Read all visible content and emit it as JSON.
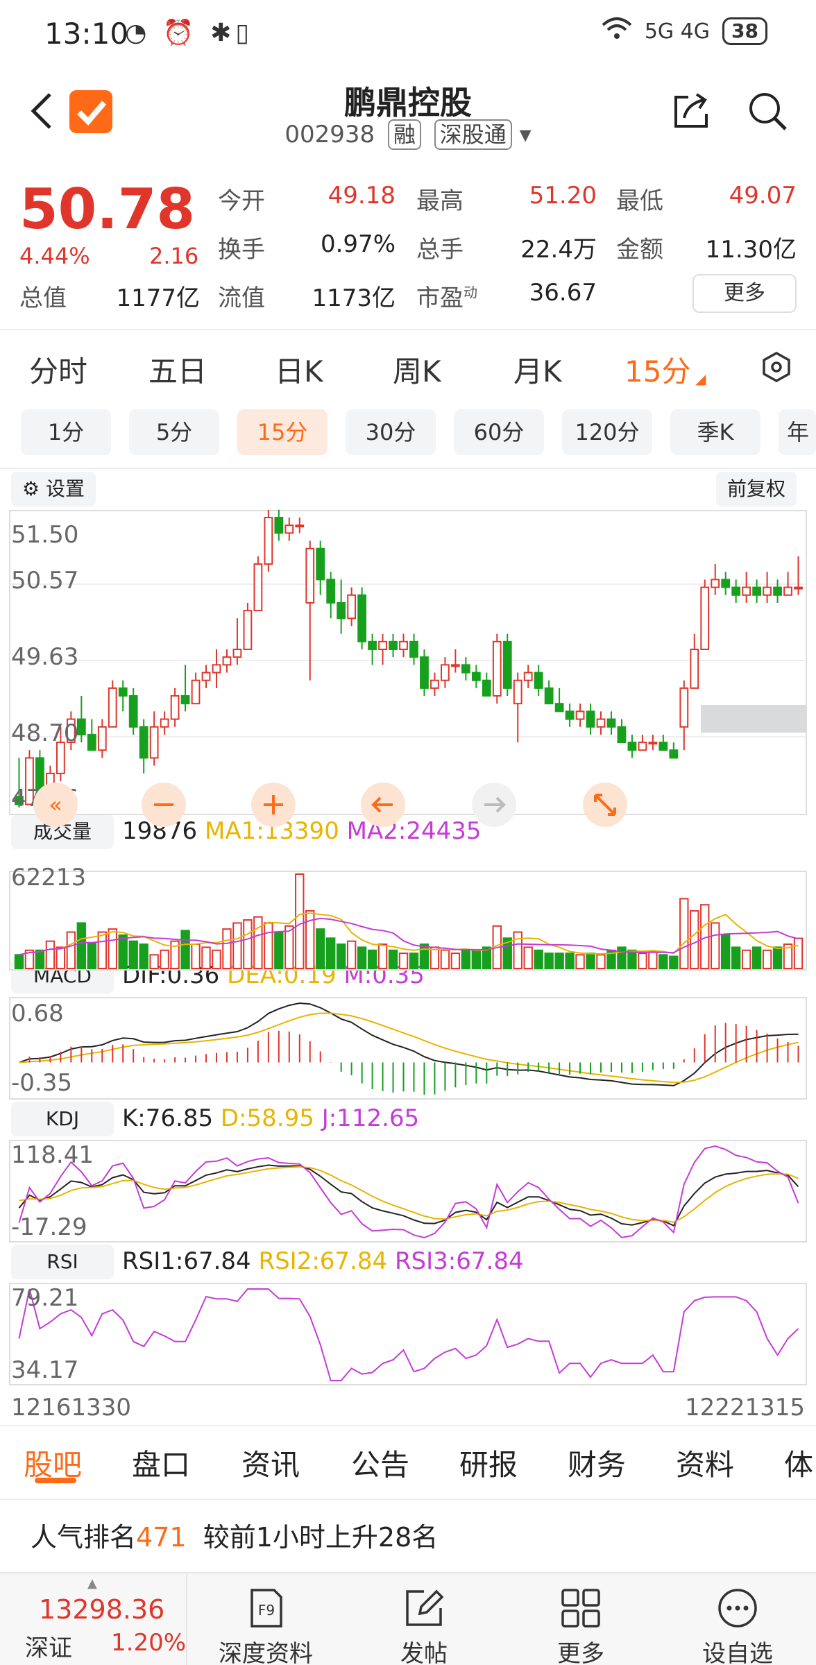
{
  "status_bar": {
    "time": "13:10",
    "icons": "◔ ⏰ ✱▯",
    "network": "5G 4G",
    "battery": "38"
  },
  "header": {
    "title": "鹏鼎控股",
    "code": "002938",
    "tag1": "融",
    "tag2": "深股通"
  },
  "quote": {
    "price": "50.78",
    "change_pct": "4.44%",
    "change_abs": "2.16",
    "fields": [
      {
        "label": "今开",
        "value": "49.18",
        "color": "red"
      },
      {
        "label": "最高",
        "value": "51.20",
        "color": "red"
      },
      {
        "label": "最低",
        "value": "49.07",
        "color": "red"
      },
      {
        "label": "换手",
        "value": "0.97%",
        "color": "black"
      },
      {
        "label": "总手",
        "value": "22.4万",
        "color": "black"
      },
      {
        "label": "金额",
        "value": "11.30亿",
        "color": "black"
      },
      {
        "label": "总值",
        "value": "1177亿",
        "color": "black"
      },
      {
        "label": "流值",
        "value": "1173亿",
        "color": "black"
      },
      {
        "label": "市盈",
        "value": "36.67",
        "color": "black"
      }
    ],
    "pe_superscript": "动",
    "more_label": "更多"
  },
  "period_tabs": [
    "分时",
    "五日",
    "日K",
    "周K",
    "月K",
    "15分"
  ],
  "active_period": "15分",
  "interval_tabs": [
    "1分",
    "5分",
    "15分",
    "30分",
    "60分",
    "120分",
    "季K",
    "年"
  ],
  "active_interval": "15分",
  "chart_controls": {
    "settings_label": "设置",
    "adjust_label": "前复权"
  },
  "colors": {
    "up": "#e0352b",
    "down": "#16a01e",
    "accent": "#ff6a18",
    "ma1": "#e7b400",
    "ma2": "#c43bd6"
  },
  "chart_data": [
    {
      "type": "candlestick",
      "y_ticks": [
        "51.50",
        "50.57",
        "49.63",
        "48.70",
        "47.76"
      ],
      "ylim": [
        47.76,
        51.5
      ],
      "candles": [
        [
          47.9,
          47.8,
          48.4,
          47.76
        ],
        [
          47.8,
          48.4,
          48.5,
          47.8
        ],
        [
          48.4,
          48.0,
          48.5,
          47.9
        ],
        [
          48.0,
          48.2,
          48.3,
          47.9
        ],
        [
          48.2,
          48.6,
          48.8,
          48.1
        ],
        [
          48.6,
          48.9,
          49.0,
          48.5
        ],
        [
          48.9,
          48.7,
          49.2,
          48.6
        ],
        [
          48.7,
          48.5,
          48.9,
          48.5
        ],
        [
          48.5,
          48.8,
          48.9,
          48.4
        ],
        [
          48.8,
          49.3,
          49.4,
          48.8
        ],
        [
          49.3,
          49.2,
          49.4,
          49.0
        ],
        [
          49.2,
          48.8,
          49.3,
          48.7
        ],
        [
          48.8,
          48.4,
          48.9,
          48.2
        ],
        [
          48.4,
          48.8,
          49.0,
          48.3
        ],
        [
          48.8,
          48.9,
          49.0,
          48.7
        ],
        [
          48.9,
          49.2,
          49.3,
          48.8
        ],
        [
          49.2,
          49.1,
          49.6,
          49.0
        ],
        [
          49.1,
          49.4,
          49.5,
          49.1
        ],
        [
          49.4,
          49.5,
          49.6,
          49.3
        ],
        [
          49.5,
          49.6,
          49.8,
          49.3
        ],
        [
          49.6,
          49.7,
          49.8,
          49.5
        ],
        [
          49.7,
          49.8,
          50.2,
          49.6
        ],
        [
          49.8,
          50.3,
          50.4,
          49.8
        ],
        [
          50.3,
          50.9,
          51.0,
          50.3
        ],
        [
          50.9,
          51.5,
          51.6,
          50.8
        ],
        [
          51.5,
          51.3,
          51.6,
          51.2
        ],
        [
          51.3,
          51.4,
          51.5,
          51.2
        ],
        [
          51.4,
          51.4,
          51.5,
          51.3
        ],
        [
          50.4,
          51.1,
          51.2,
          49.4
        ],
        [
          51.1,
          50.7,
          51.2,
          50.5
        ],
        [
          50.7,
          50.4,
          50.8,
          50.2
        ],
        [
          50.4,
          50.2,
          50.7,
          50.0
        ],
        [
          50.2,
          50.5,
          50.6,
          50.1
        ],
        [
          50.5,
          49.9,
          50.6,
          49.8
        ],
        [
          49.9,
          49.8,
          50.0,
          49.6
        ],
        [
          49.8,
          49.9,
          50.0,
          49.6
        ],
        [
          49.9,
          49.8,
          50.0,
          49.7
        ],
        [
          49.8,
          49.9,
          50.0,
          49.7
        ],
        [
          49.9,
          49.7,
          50.0,
          49.6
        ],
        [
          49.7,
          49.3,
          49.8,
          49.2
        ],
        [
          49.3,
          49.4,
          49.5,
          49.2
        ],
        [
          49.4,
          49.6,
          49.7,
          49.3
        ],
        [
          49.6,
          49.6,
          49.8,
          49.5
        ],
        [
          49.6,
          49.5,
          49.7,
          49.4
        ],
        [
          49.5,
          49.4,
          49.6,
          49.3
        ],
        [
          49.4,
          49.2,
          49.5,
          49.2
        ],
        [
          49.2,
          49.9,
          50.0,
          49.1
        ],
        [
          49.9,
          49.3,
          50.0,
          49.2
        ],
        [
          49.1,
          49.4,
          49.5,
          48.6
        ],
        [
          49.4,
          49.5,
          49.6,
          49.3
        ],
        [
          49.5,
          49.3,
          49.6,
          49.2
        ],
        [
          49.3,
          49.1,
          49.4,
          49.1
        ],
        [
          49.1,
          49.0,
          49.3,
          49.0
        ],
        [
          49.0,
          48.9,
          49.1,
          48.8
        ],
        [
          48.9,
          49.0,
          49.1,
          48.8
        ],
        [
          49.0,
          48.8,
          49.1,
          48.7
        ],
        [
          48.8,
          48.9,
          49.0,
          48.7
        ],
        [
          48.9,
          48.8,
          49.0,
          48.7
        ],
        [
          48.8,
          48.6,
          48.9,
          48.6
        ],
        [
          48.6,
          48.5,
          48.7,
          48.4
        ],
        [
          48.5,
          48.6,
          48.7,
          48.5
        ],
        [
          48.6,
          48.6,
          48.7,
          48.5
        ],
        [
          48.6,
          48.5,
          48.7,
          48.5
        ],
        [
          48.5,
          48.4,
          48.6,
          48.4
        ],
        [
          48.8,
          49.3,
          49.4,
          48.5
        ],
        [
          49.3,
          49.8,
          50.0,
          49.3
        ],
        [
          49.8,
          50.6,
          50.7,
          49.8
        ],
        [
          50.6,
          50.7,
          50.9,
          50.5
        ],
        [
          50.7,
          50.6,
          50.8,
          50.5
        ],
        [
          50.6,
          50.5,
          50.7,
          50.4
        ],
        [
          50.5,
          50.6,
          50.8,
          50.4
        ],
        [
          50.6,
          50.5,
          50.7,
          50.4
        ],
        [
          50.5,
          50.6,
          50.8,
          50.4
        ],
        [
          50.6,
          50.5,
          50.7,
          50.4
        ],
        [
          50.5,
          50.6,
          50.8,
          50.5
        ],
        [
          50.6,
          50.6,
          51.0,
          50.5
        ]
      ]
    },
    {
      "type": "bar",
      "name": "成交量",
      "current": "19876",
      "ma1_label": "MA1:13390",
      "ma2_label": "MA2:24435",
      "y_max_label": "62213",
      "ylim": [
        0,
        62213
      ],
      "values": [
        9000,
        12000,
        12000,
        18000,
        14000,
        24000,
        30000,
        17000,
        24000,
        26000,
        22000,
        18000,
        16000,
        9000,
        12000,
        18000,
        25000,
        16000,
        14000,
        12000,
        26000,
        30000,
        32000,
        34000,
        30000,
        24000,
        28000,
        62213,
        38000,
        26000,
        20000,
        16000,
        18000,
        14000,
        12000,
        16000,
        12000,
        10000,
        10000,
        16000,
        14000,
        12000,
        10000,
        12000,
        12000,
        14000,
        28000,
        20000,
        24000,
        14000,
        12000,
        10000,
        10000,
        10000,
        9000,
        10000,
        9000,
        12000,
        14000,
        12000,
        10000,
        11000,
        9000,
        8000,
        46000,
        38000,
        42000,
        30000,
        22000,
        14000,
        12000,
        14000,
        12000,
        14000,
        16000,
        19876
      ]
    },
    {
      "type": "line",
      "name": "MACD",
      "dif_label": "DIF:0.36",
      "dea_label": "DEA:0.19",
      "m_label": "M:0.35",
      "y_ticks": [
        "0.68",
        "-0.35"
      ],
      "ylim": [
        -0.35,
        0.68
      ]
    },
    {
      "type": "line",
      "name": "KDJ",
      "k_label": "K:76.85",
      "d_label": "D:58.95",
      "j_label": "J:112.65",
      "y_ticks": [
        "118.41",
        "-17.29"
      ],
      "ylim": [
        -17.29,
        118.41
      ]
    },
    {
      "type": "line",
      "name": "RSI",
      "rsi1_label": "RSI1:67.84",
      "rsi2_label": "RSI2:67.84",
      "rsi3_label": "RSI3:67.84",
      "y_ticks": [
        "79.21",
        "34.17"
      ],
      "ylim": [
        34.17,
        79.21
      ],
      "x_labels": [
        "12161330",
        "12221315"
      ]
    }
  ],
  "bottom_tabs": [
    "股吧",
    "盘口",
    "资讯",
    "公告",
    "研报",
    "财务",
    "资料",
    "体"
  ],
  "rank": {
    "prefix": "人气排名",
    "value": "471",
    "suffix": "较前1小时上升28名"
  },
  "bottom_bar": {
    "index_value": "13298.36",
    "index_name": "深证",
    "index_change": "1.20%",
    "items": [
      "深度资料",
      "发帖",
      "更多",
      "设自选"
    ]
  }
}
